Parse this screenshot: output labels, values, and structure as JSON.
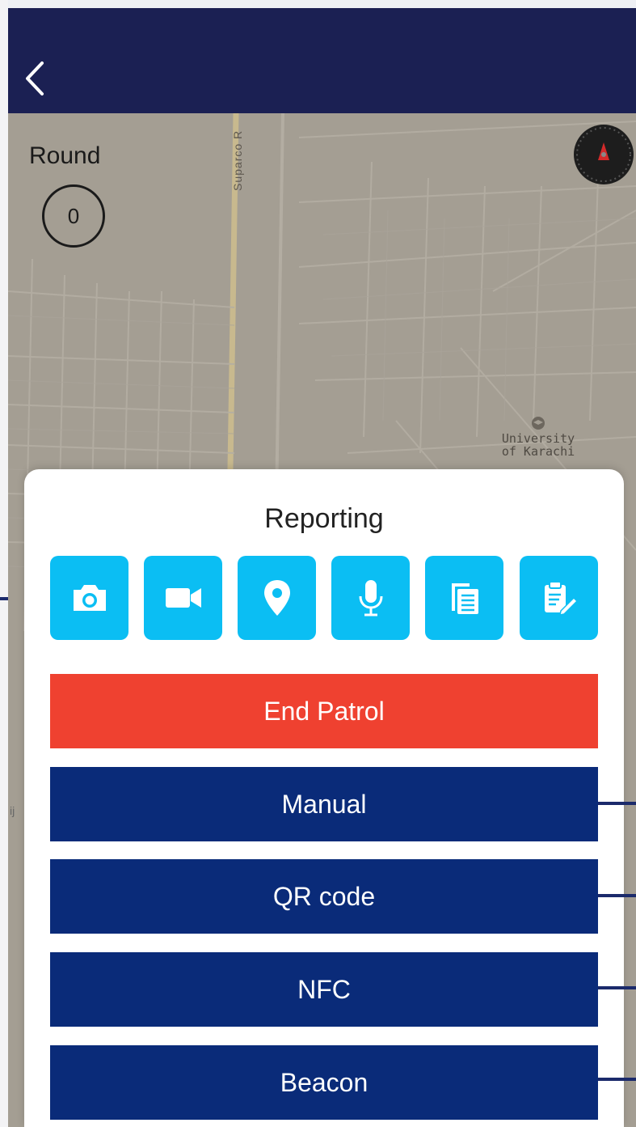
{
  "round": {
    "label": "Round",
    "count": "0"
  },
  "map": {
    "road_label": "Suparco R",
    "poi_label_line1": "University",
    "poi_label_line2": "of Karachi",
    "edge_text": "ij"
  },
  "panel": {
    "title": "Reporting",
    "icons": [
      {
        "name": "camera-icon"
      },
      {
        "name": "video-camera-icon"
      },
      {
        "name": "location-pin-icon"
      },
      {
        "name": "microphone-icon"
      },
      {
        "name": "copy-documents-icon"
      },
      {
        "name": "clipboard-edit-icon"
      }
    ],
    "buttons": {
      "end_patrol": "End Patrol",
      "manual": "Manual",
      "qr_code": "QR code",
      "nfc": "NFC",
      "beacon": "Beacon"
    }
  },
  "colors": {
    "navbar": "#1b2053",
    "icon_button": "#0bbef3",
    "end_patrol": "#ef4130",
    "action_button": "#0a2b79"
  }
}
